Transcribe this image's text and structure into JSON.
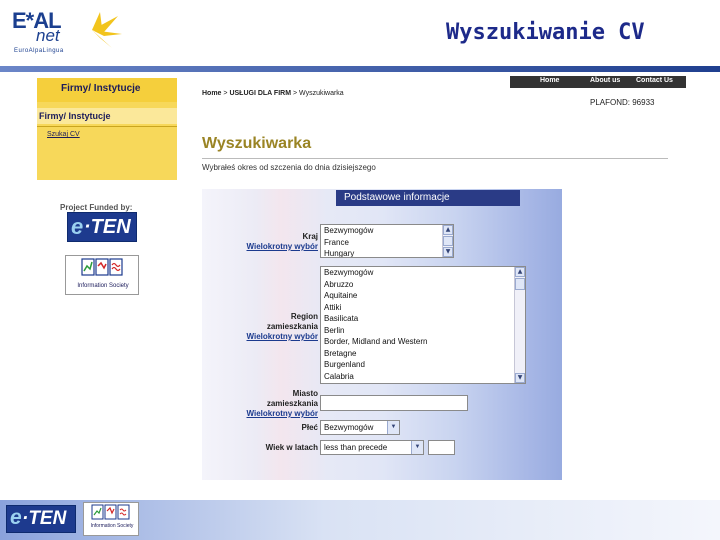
{
  "slide": {
    "title": "Wyszukiwanie CV",
    "logo": {
      "brand": "E*AL",
      "brand2": "net",
      "tagline": "EuroAlpaLingua"
    }
  },
  "sidebar": {
    "header": "Firmy/ Instytucje",
    "item": "Firmy/ Instytucje",
    "subitem": "Szukaj CV",
    "funded_label": "Project Funded by:",
    "eten_logo": "e-TEN",
    "infosoc_logo": "Information Society"
  },
  "topnav": {
    "items": [
      "Home",
      "About us",
      "Contact Us"
    ]
  },
  "breadcrumb": {
    "home": "Home",
    "sep1": ">",
    "section": "USŁUGI DLA FIRM",
    "sep2": ">",
    "current": "Wyszukiwarka"
  },
  "plafond": "PLAFOND: 96933",
  "page": {
    "title": "Wyszukiwarka",
    "subtitle": "Wybrałeś okres od szczenia do dnia dzisiejszego"
  },
  "form": {
    "section_header": "Podstawowe informacje",
    "kraj": {
      "label": "Kraj",
      "link": "Wielokrotny wybór",
      "options": [
        "Bezwymogów",
        "France",
        "Hungary"
      ]
    },
    "region": {
      "label1": "Region",
      "label2": "zamieszkania",
      "link": "Wielokrotny wybór",
      "options": [
        "Bezwymogów",
        "Abruzzo",
        "Aquitaine",
        "Attiki",
        "Basilicata",
        "Berlin",
        "Border, Midland and Western",
        "Bretagne",
        "Burgenland",
        "Calabria"
      ]
    },
    "miasto": {
      "label1": "Miasto",
      "label2": "zamieszkania",
      "link": "Wielokrotny wybór",
      "value": ""
    },
    "plec": {
      "label": "Płeć",
      "value": "Bezwymogów"
    },
    "wiek": {
      "label": "Wiek w latach",
      "select_value": "less than precede",
      "value": ""
    }
  },
  "footer": {
    "eten_logo": "e-TEN",
    "infosoc_logo": "Information Society"
  },
  "colors": {
    "title": "#1d2a8a",
    "accent_yellow": "#f5cf3c",
    "form_header": "#2a3b86",
    "page_title": "#9a8424",
    "link": "#1b3a8e"
  }
}
